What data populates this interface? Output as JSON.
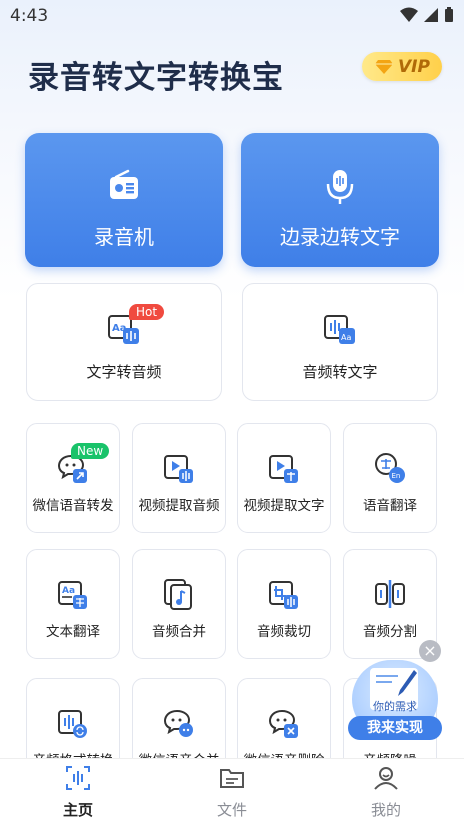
{
  "status": {
    "time": "4:43"
  },
  "app": {
    "title": "录音转文字转换宝",
    "vip_label": "VIP"
  },
  "big_cards": [
    {
      "label": "录音机",
      "icon": "radio-icon"
    },
    {
      "label": "边录边转文字",
      "icon": "microphone-icon"
    }
  ],
  "mid_cards": [
    {
      "label": "文字转音频",
      "icon": "text-to-audio-icon",
      "tag": "Hot"
    },
    {
      "label": "音频转文字",
      "icon": "audio-to-text-icon"
    }
  ],
  "tools": [
    {
      "label": "微信语音转发",
      "icon": "wechat-forward-icon",
      "tag": "New"
    },
    {
      "label": "视频提取音频",
      "icon": "video-extract-audio-icon"
    },
    {
      "label": "视频提取文字",
      "icon": "video-extract-text-icon"
    },
    {
      "label": "语音翻译",
      "icon": "voice-translate-icon"
    },
    {
      "label": "文本翻译",
      "icon": "text-translate-icon"
    },
    {
      "label": "音频合并",
      "icon": "audio-merge-icon"
    },
    {
      "label": "音频裁切",
      "icon": "audio-crop-icon"
    },
    {
      "label": "音频分割",
      "icon": "audio-split-icon"
    },
    {
      "label": "音频格式转换",
      "icon": "audio-format-convert-icon"
    },
    {
      "label": "微信语音合并",
      "icon": "wechat-voice-merge-icon"
    },
    {
      "label": "微信语音删除",
      "icon": "wechat-voice-delete-icon"
    },
    {
      "label": "音频降噪",
      "icon": "audio-denoise-icon"
    }
  ],
  "float_ad": {
    "need_text": "你的需求",
    "cta": "我来实现",
    "close": "×"
  },
  "nav": [
    {
      "label": "主页",
      "active": true
    },
    {
      "label": "文件",
      "active": false
    },
    {
      "label": "我的",
      "active": false
    }
  ],
  "colors": {
    "primary": "#3f7fe8",
    "hot": "#f04a3f",
    "new": "#19c36a",
    "vip": "#ffd04a"
  }
}
